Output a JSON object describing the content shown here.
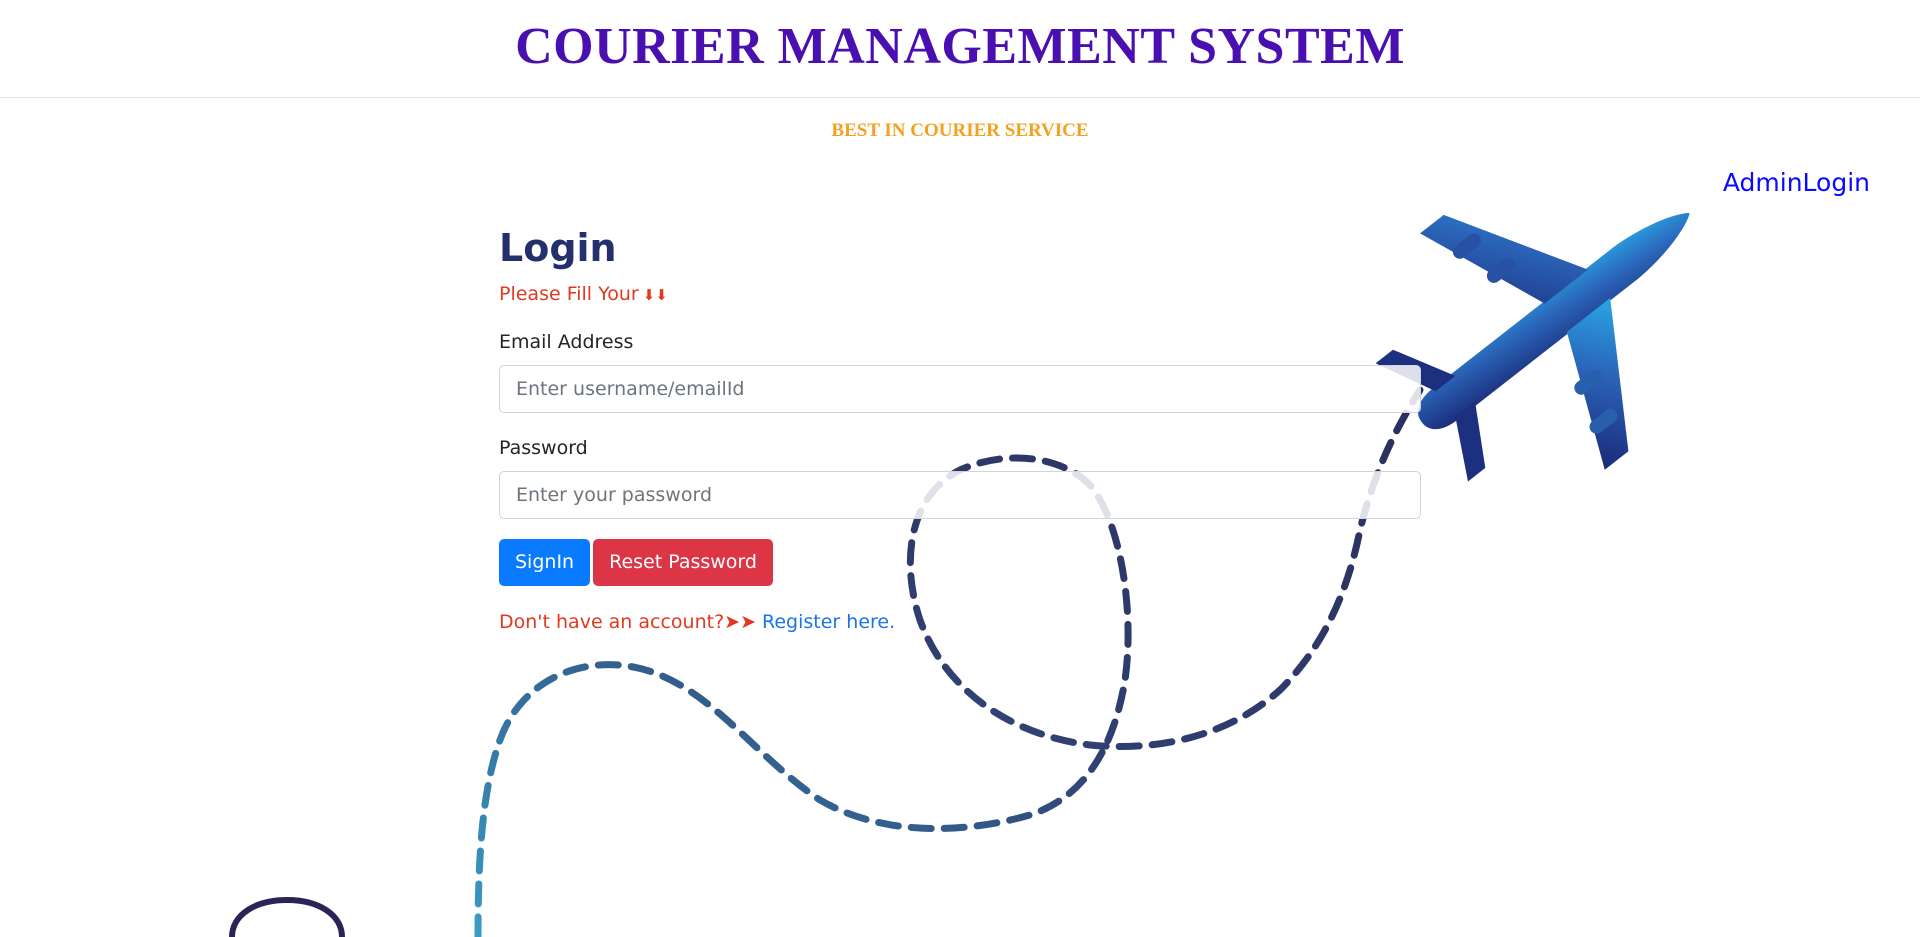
{
  "header": {
    "title": "COURIER MANAGEMENT SYSTEM"
  },
  "tagline": "BEST IN COURIER SERVICE",
  "nav": {
    "admin_login": "AdminLogin"
  },
  "login": {
    "title": "Login",
    "fill_note": "Please Fill Your",
    "fill_arrows": "⬇⬇",
    "email_label": "Email Address",
    "email_placeholder": "Enter username/emailId",
    "email_value": "",
    "password_label": "Password",
    "password_placeholder": "Enter your password",
    "password_value": "",
    "signin_label": "SignIn",
    "reset_label": "Reset Password",
    "no_account_text": "Don't have an account?➤➤",
    "register_link": "Register here."
  },
  "colors": {
    "title": "#4a0fb0",
    "tagline": "#f5a020",
    "admin_link": "#0a0aff",
    "login_title": "#24306b",
    "note": "#e0391f",
    "signin_button": "#0a7bff",
    "reset_button": "#dc3545",
    "register_link": "#1a76e6"
  },
  "icons": {
    "background_airplane": "airplane-icon",
    "background_globe": "globe-icon"
  }
}
